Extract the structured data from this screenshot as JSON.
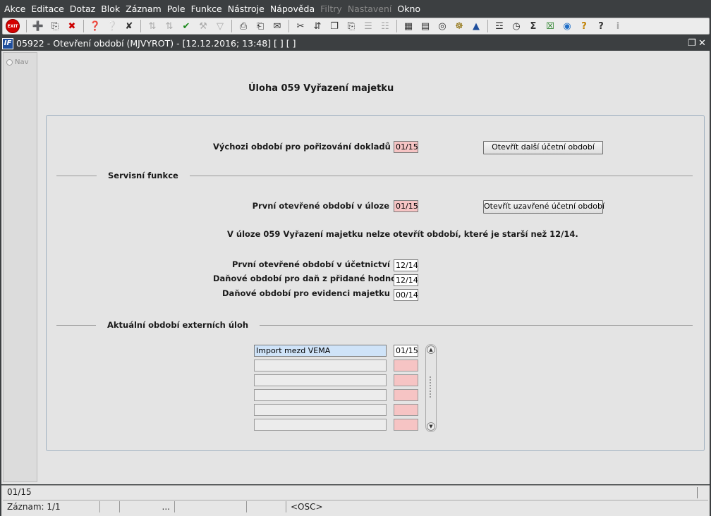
{
  "menu": [
    "Akce",
    "Editace",
    "Dotaz",
    "Blok",
    "Záznam",
    "Pole",
    "Funkce",
    "Nástroje",
    "Nápověda",
    "Filtry",
    "Nastavení",
    "Okno"
  ],
  "menu_disabled": [
    "Filtry",
    "Nastavení"
  ],
  "toolbar": {
    "exit_label": "EXIT",
    "icons": [
      "add-record-icon",
      "copy-record-icon",
      "delete-record-icon",
      "enter-query-icon",
      "execute-query-icon",
      "cancel-query-icon",
      "sort-asc-icon",
      "sort-desc-icon",
      "commit-checkmark-icon",
      "tools-icon",
      "filter-icon",
      "print-icon",
      "print-preview-icon",
      "mail-icon",
      "cut-icon",
      "move-icon",
      "copy-icon",
      "paste-icon",
      "list-icon",
      "tree-icon",
      "calculator-icon",
      "document-icon",
      "globe-icon",
      "settings-icon",
      "triangle-icon",
      "chart-icon",
      "timer-icon",
      "sum-icon",
      "excel-icon",
      "browser-icon",
      "help-query-icon",
      "help-icon",
      "info-icon"
    ]
  },
  "window": {
    "title": "05922 - Otevření období (MJVYROT) - [12.12.2016; 13:48]  [ ]  [ ]"
  },
  "nav": {
    "label": "Nav"
  },
  "form": {
    "heading": "Úloha  059 Vyřazení majetku",
    "default_period_label": "Výchozi období pro pořizování dokladů",
    "default_period_value": "01/15",
    "open_next_button": "Otevřít další účetní období",
    "service_section": "Servisní funkce",
    "first_open_label": "První otevřené období v úloze",
    "first_open_value": "01/15",
    "open_closed_button": "Otevřít uzavřené účetní období",
    "info_text": "V úloze 059 Vyřazení majetku nelze otevřít období, které je starší než 12/14.",
    "accounting_label": "První otevřené období v účetnictví",
    "accounting_value": "12/14",
    "vat_label": "Daňové období pro daň z přidané hodnoty",
    "vat_value": "12/14",
    "asset_label": "Daňové období pro evidenci majetku",
    "asset_value": "00/14",
    "external_section": "Aktuální období externích úloh",
    "external_rows": [
      {
        "name": "Import mezd VEMA",
        "period": "01/15"
      },
      {
        "name": "",
        "period": ""
      },
      {
        "name": "",
        "period": ""
      },
      {
        "name": "",
        "period": ""
      },
      {
        "name": "",
        "period": ""
      },
      {
        "name": "",
        "period": ""
      }
    ]
  },
  "status": {
    "message": "01/15",
    "record": "Záznam: 1/1",
    "ellipsis": "...",
    "mode": "<OSC>"
  }
}
